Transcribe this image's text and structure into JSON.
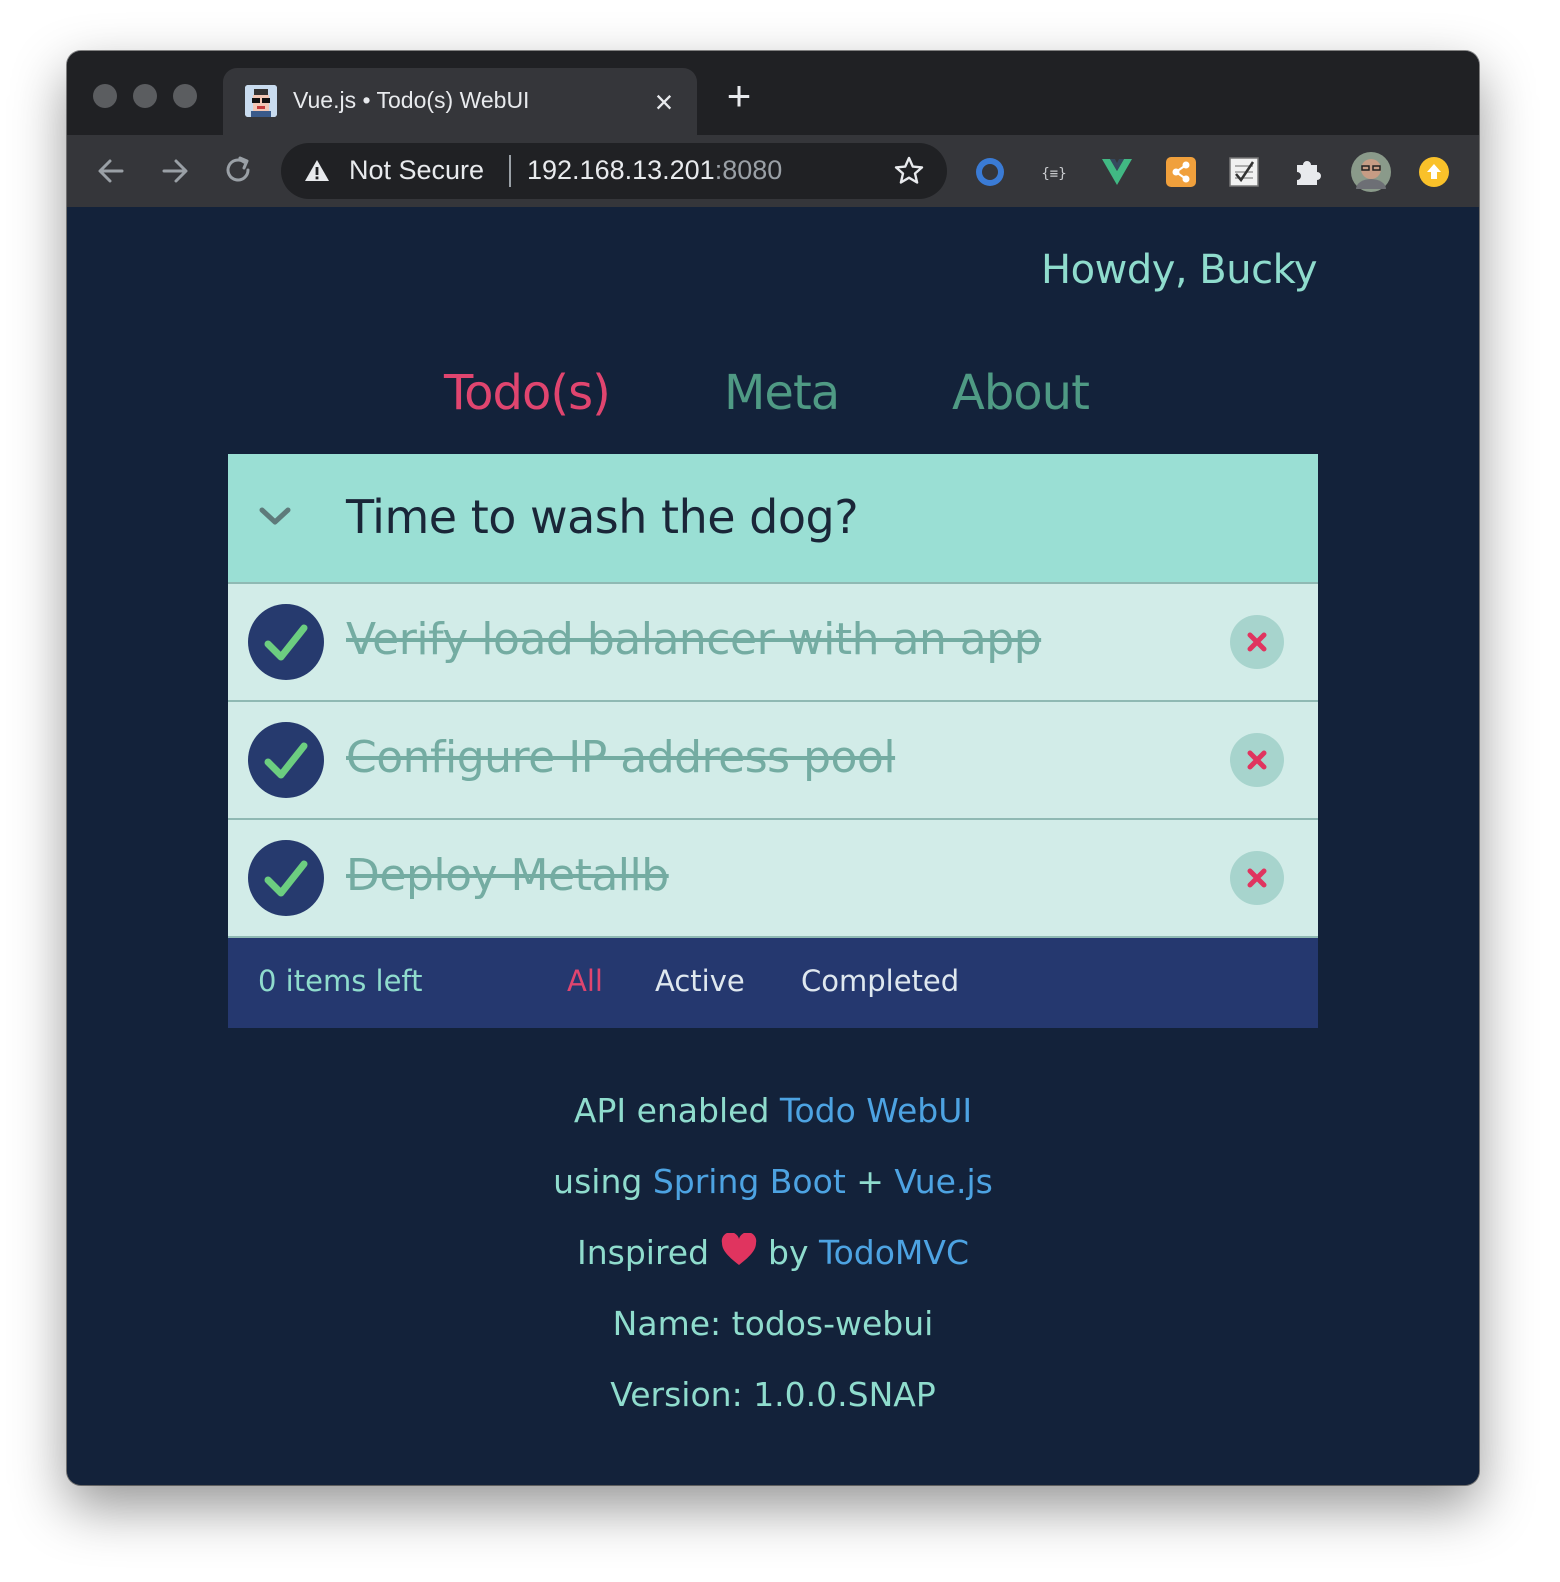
{
  "browser": {
    "tab_title": "Vue.js • Todo(s) WebUI",
    "close_glyph": "×",
    "new_tab_glyph": "+",
    "security_label": "Not Secure",
    "url_host": "192.168.13.201",
    "url_port": ":8080"
  },
  "header": {
    "greeting": "Howdy, Bucky"
  },
  "nav": {
    "todos": "Todo(s)",
    "meta": "Meta",
    "about": "About"
  },
  "todo_input": {
    "value": "Time to wash the dog?"
  },
  "todos": [
    {
      "title": "Verify load balancer with an app",
      "completed": true
    },
    {
      "title": "Configure IP address pool",
      "completed": true
    },
    {
      "title": "Deploy Metallb",
      "completed": true
    }
  ],
  "footer": {
    "items_left": "0 items left",
    "filters": {
      "all": "All",
      "active": "Active",
      "completed": "Completed"
    }
  },
  "info": {
    "api_prefix": "API enabled ",
    "api_link": "Todo WebUI",
    "using": "using ",
    "spring": "Spring Boot",
    "plus": " + ",
    "vue": "Vue.js",
    "inspired": "Inspired ",
    "by": " by ",
    "todomvc": "TodoMVC",
    "name": "Name: todos-webui",
    "version": "Version: 1.0.0.SNAP"
  },
  "colors": {
    "background": "#13223a",
    "accent_active": "#e0456f",
    "nav_inactive": "#4f9a84",
    "teal_text": "#8fdccd",
    "link": "#4da3e2",
    "header_bar": "#9adfd4",
    "row_bg": "#d2ece8",
    "footer_bar": "#25386f"
  }
}
